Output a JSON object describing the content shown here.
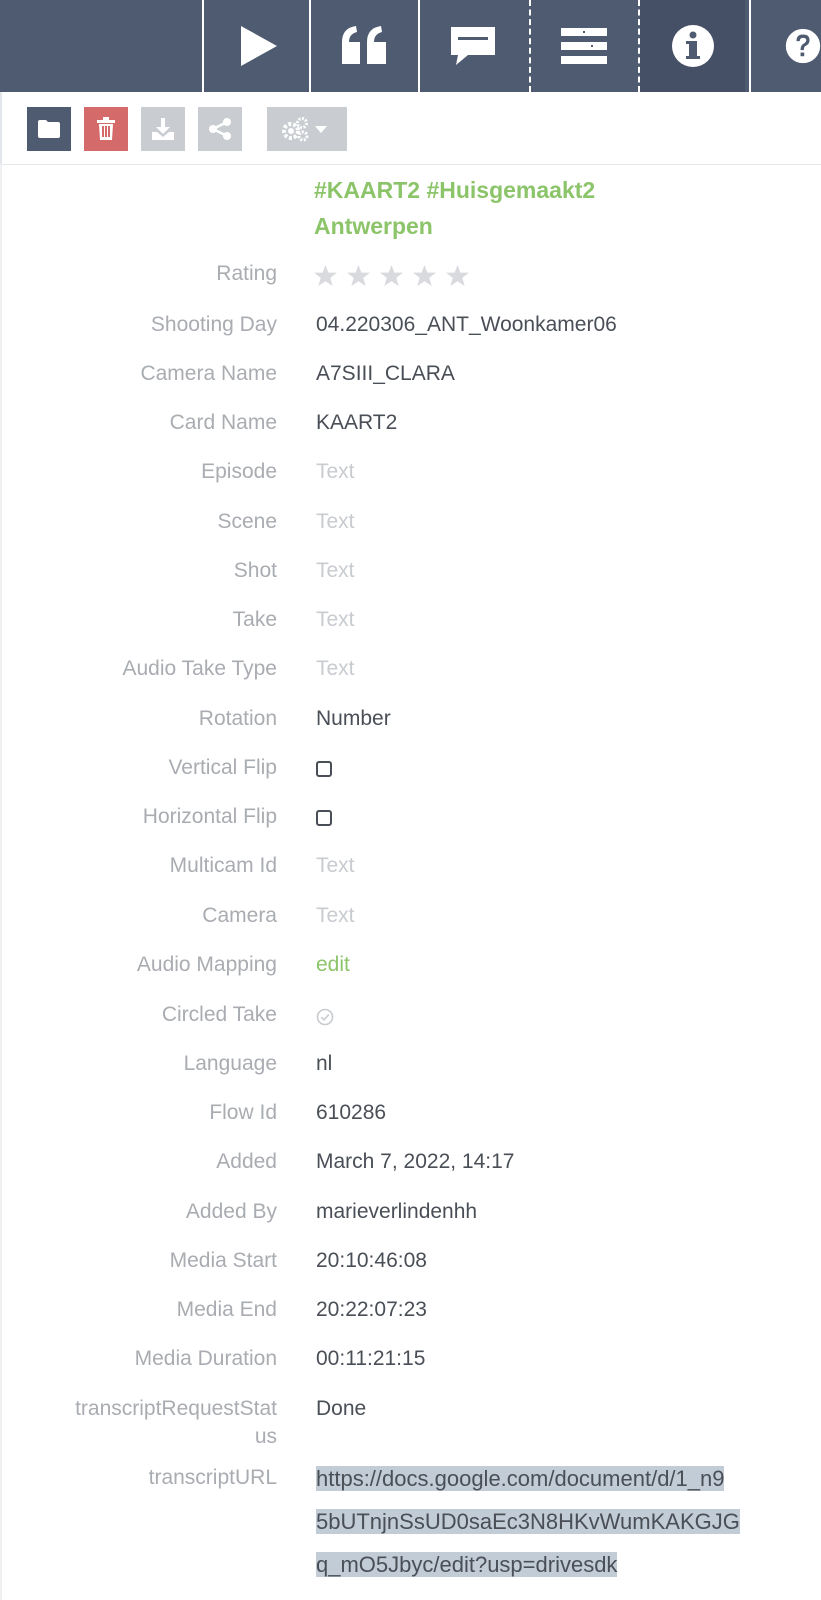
{
  "colors": {
    "topbar": "#4f5b70",
    "accent_green": "#8cc46a",
    "danger": "#d46a6a",
    "label_gray": "#a9acb1",
    "value_dark": "#4a4f57",
    "selection": "#c2ccd6"
  },
  "topnav": {
    "tabs": [
      {
        "icon": "play-icon"
      },
      {
        "icon": "quote-icon"
      },
      {
        "icon": "comment-icon"
      },
      {
        "icon": "list-icon"
      },
      {
        "icon": "info-icon"
      },
      {
        "icon": "help-icon"
      }
    ]
  },
  "toolbar": {
    "buttons": [
      {
        "icon": "folder-icon"
      },
      {
        "icon": "trash-icon"
      },
      {
        "icon": "download-icon"
      },
      {
        "icon": "share-icon"
      },
      {
        "icon": "gears-dropdown-icon"
      }
    ]
  },
  "asset": {
    "title_line1": "#KAART2 #Huisgemaakt2",
    "title_line2": "Antwerpen",
    "rating_stars": 0,
    "rating_max": 5
  },
  "fields": {
    "rating": {
      "label": "Rating"
    },
    "shooting_day": {
      "label": "Shooting Day",
      "value": "04.220306_ANT_Woonkamer06"
    },
    "camera_name": {
      "label": "Camera Name",
      "value": "A7SIII_CLARA"
    },
    "card_name": {
      "label": "Card Name",
      "value": "KAART2"
    },
    "episode": {
      "label": "Episode",
      "placeholder": "Text"
    },
    "scene": {
      "label": "Scene",
      "placeholder": "Text"
    },
    "shot": {
      "label": "Shot",
      "placeholder": "Text"
    },
    "take": {
      "label": "Take",
      "placeholder": "Text"
    },
    "audio_take_type": {
      "label": "Audio Take Type",
      "placeholder": "Text"
    },
    "rotation": {
      "label": "Rotation",
      "value": "Number"
    },
    "vertical_flip": {
      "label": "Vertical Flip",
      "checked": false
    },
    "horizontal_flip": {
      "label": "Horizontal Flip",
      "checked": false
    },
    "multicam_id": {
      "label": "Multicam Id",
      "placeholder": "Text"
    },
    "camera": {
      "label": "Camera",
      "placeholder": "Text"
    },
    "audio_mapping": {
      "label": "Audio Mapping",
      "link": "edit"
    },
    "circled_take": {
      "label": "Circled Take",
      "checked": false
    },
    "language": {
      "label": "Language",
      "value": "nl"
    },
    "flow_id": {
      "label": "Flow Id",
      "value": "610286"
    },
    "added": {
      "label": "Added",
      "value": "March 7, 2022, 14:17"
    },
    "added_by": {
      "label": "Added By",
      "value": "marieverlindenhh"
    },
    "media_start": {
      "label": "Media Start",
      "value": "20:10:46:08"
    },
    "media_end": {
      "label": "Media End",
      "value": "20:22:07:23"
    },
    "media_duration": {
      "label": "Media Duration",
      "value": "00:11:21:15"
    },
    "transcript_request_status": {
      "label_line1": "transcriptRequestStat",
      "label_line2": "us",
      "value": "Done"
    },
    "transcript_url": {
      "label": "transcriptURL",
      "value_line1": "https://docs.google.com/document/d/1_n9",
      "value_line2": "5bUTnjnSsUD0saEc3N8HKvWumKAKGJG",
      "value_line3": "q_mO5Jbyc/edit?usp=drivesdk"
    }
  }
}
